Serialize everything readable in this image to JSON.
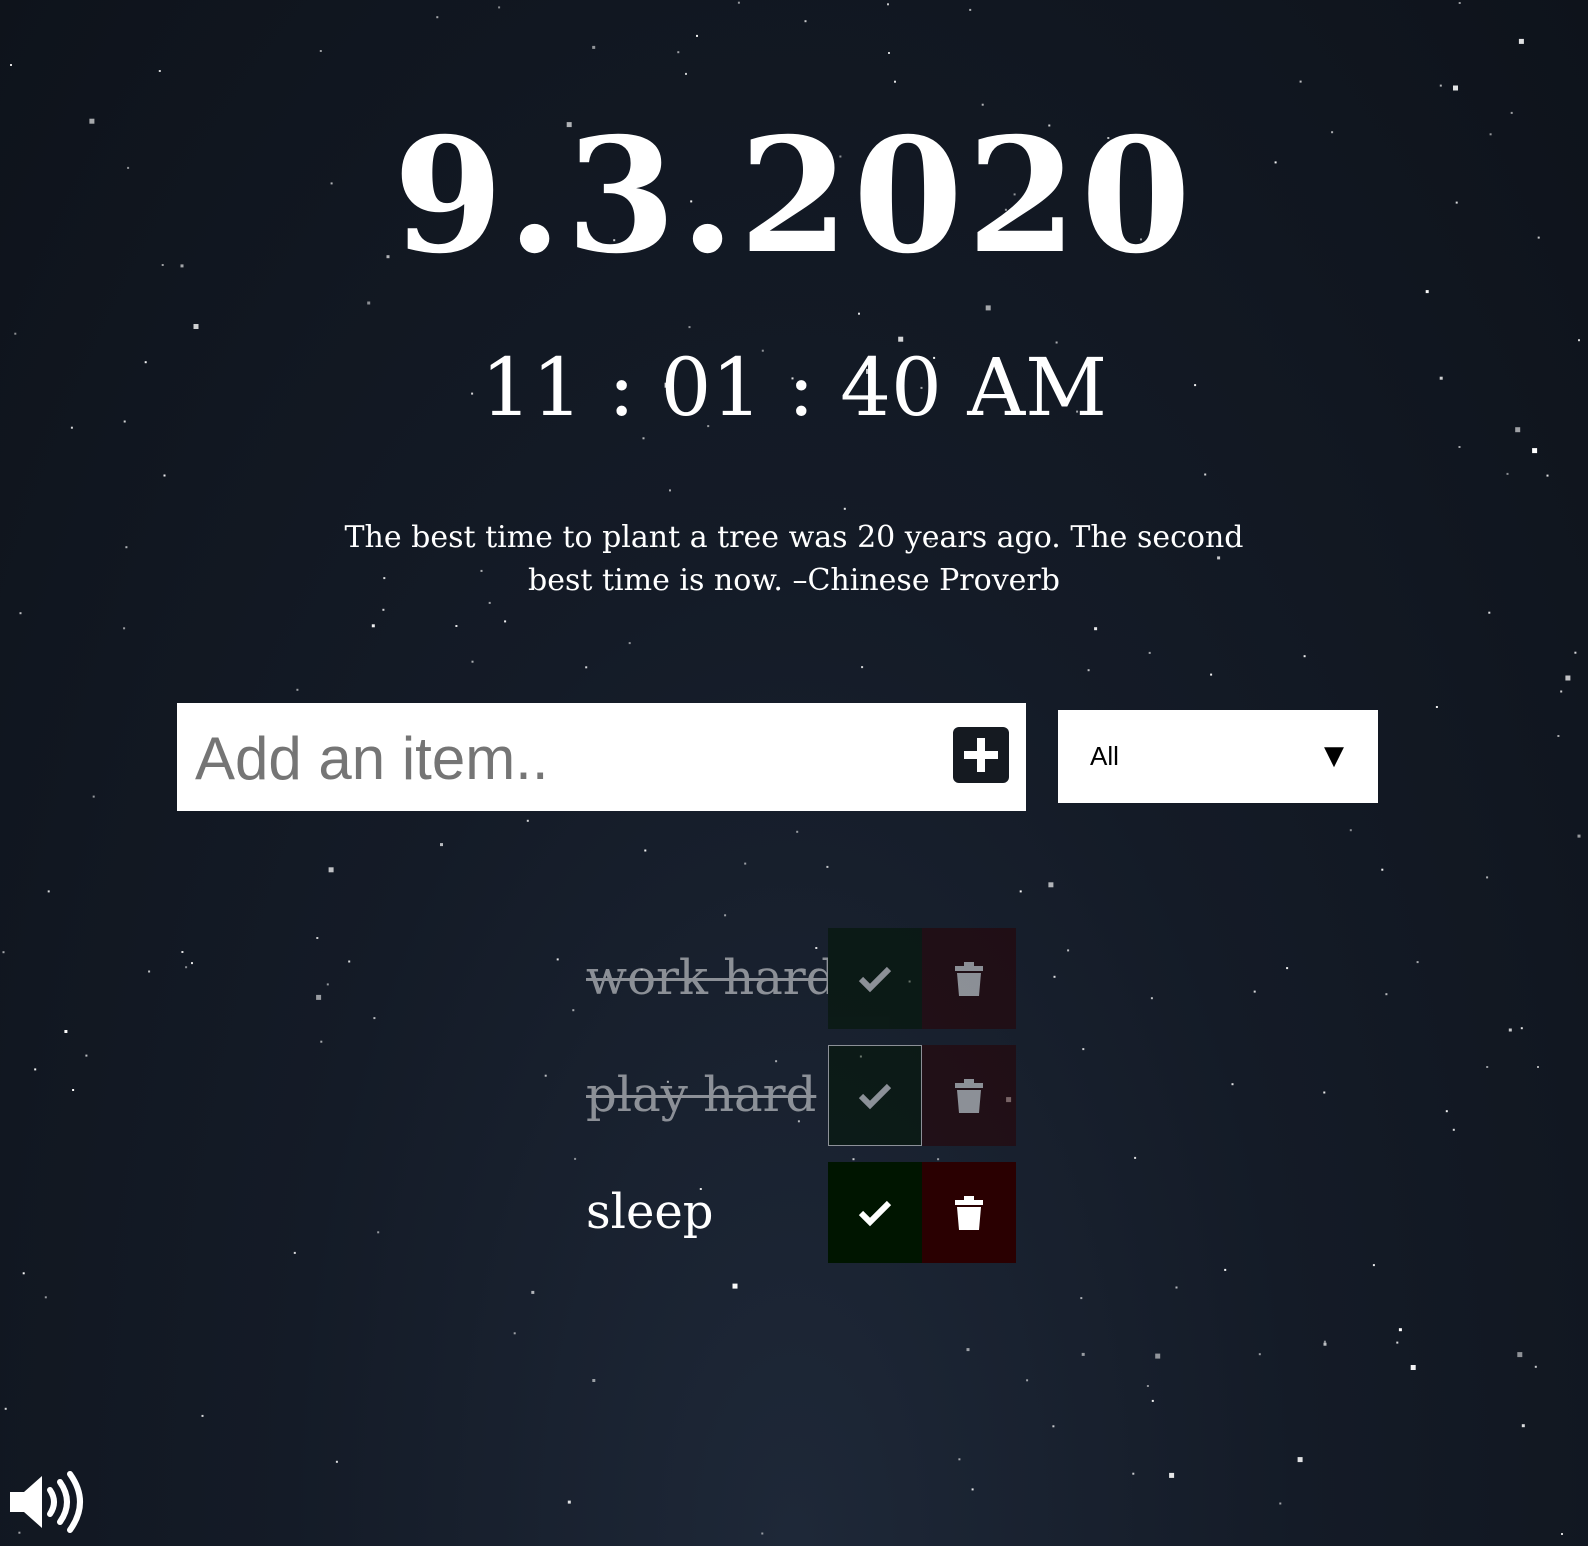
{
  "clock": {
    "date": "9.3.2020",
    "time": "11 : 01 : 40 AM"
  },
  "quote": {
    "text": "The best time to plant a tree was 20 years ago. The second best time is now. –Chinese Proverb"
  },
  "todo_form": {
    "placeholder": "Add an item..",
    "add_icon": "plus-square-icon"
  },
  "filter": {
    "selected": "All",
    "arrow": "▼"
  },
  "todos": [
    {
      "text": "work hard",
      "completed": true
    },
    {
      "text": "play hard",
      "completed": true
    },
    {
      "text": "sleep",
      "completed": false
    }
  ],
  "icons": {
    "check": "check-icon",
    "trash": "trash-icon",
    "sound": "volume-up-icon"
  },
  "colors": {
    "check_bg": "#001500",
    "trash_bg": "#2a0001",
    "background": "#141b27"
  }
}
